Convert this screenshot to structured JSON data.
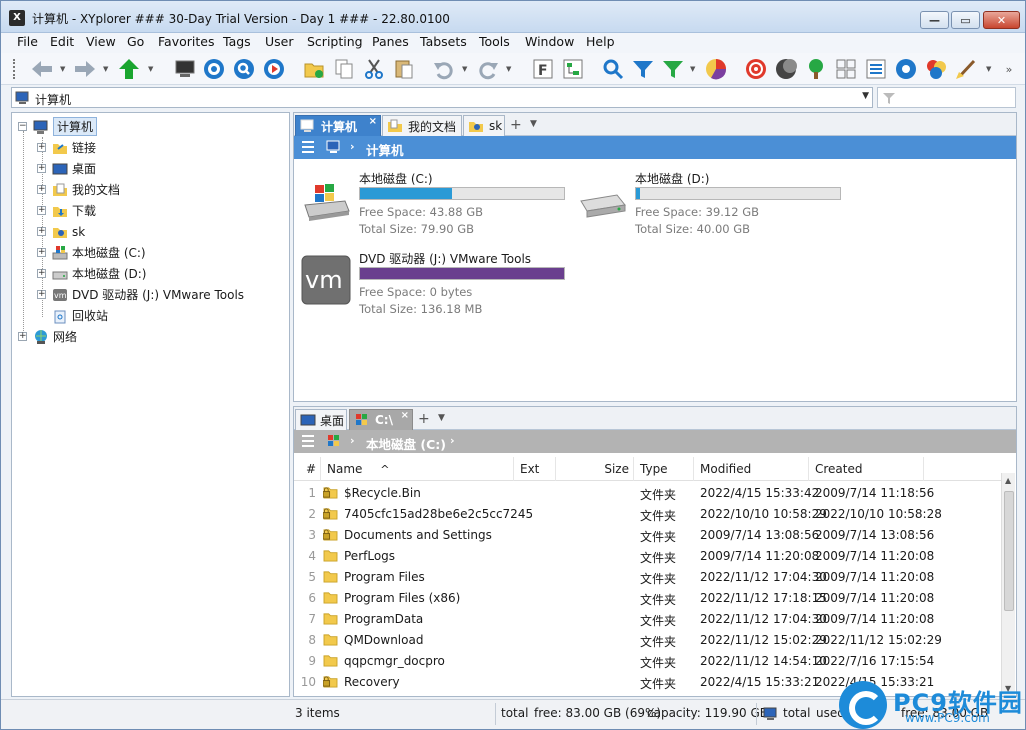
{
  "window": {
    "title": "计算机 - XYplorer ### 30-Day Trial Version - Day 1 ### - 22.80.0100",
    "app_icon_text": "X"
  },
  "menu": [
    "File",
    "Edit",
    "View",
    "Go",
    "Favorites",
    "Tags",
    "User",
    "Scripting",
    "Panes",
    "Tabsets",
    "Tools",
    "Window",
    "Help"
  ],
  "toolbar_icons": [
    "back-arrow-icon",
    "forward-arrow-icon",
    "up-arrow-icon",
    "computer-icon",
    "target-icon",
    "find-icon",
    "go-icon",
    "new-folder-icon",
    "copy-icon",
    "cut-icon",
    "paste-icon",
    "undo-icon",
    "redo-icon",
    "f-icon",
    "tree-icon",
    "search-icon",
    "filter-icon",
    "filter-green-icon",
    "pie-icon",
    "spiral-icon",
    "moon-icon",
    "tree-green-icon",
    "grid-icon",
    "list-icon",
    "gear-icon",
    "colors-icon",
    "brush-icon"
  ],
  "address": {
    "value": "计算机"
  },
  "tree": [
    {
      "label": "计算机",
      "level": 0
    },
    {
      "label": "链接",
      "level": 1
    },
    {
      "label": "桌面",
      "level": 1
    },
    {
      "label": "我的文档",
      "level": 1
    },
    {
      "label": "下载",
      "level": 1
    },
    {
      "label": "sk",
      "level": 1
    },
    {
      "label": "本地磁盘 (C:)",
      "level": 1
    },
    {
      "label": "本地磁盘 (D:)",
      "level": 1
    },
    {
      "label": "DVD 驱动器 (J:) VMware Tools",
      "level": 1
    },
    {
      "label": "回收站",
      "level": 1
    },
    {
      "label": "网络",
      "level": 0
    }
  ],
  "pane1": {
    "tabs": [
      {
        "label": "计算机",
        "active": true
      },
      {
        "label": "我的文档",
        "active": false
      },
      {
        "label": "sk",
        "active": false
      }
    ],
    "tab_close": "×",
    "tab_add": "+",
    "tab_more": "▼",
    "breadcrumb": "计算机",
    "drives": [
      {
        "name": "本地磁盘 (C:)",
        "free": "Free Space: 43.88 GB",
        "total": "Total Size: 79.90 GB",
        "used_fraction": 0.45,
        "color": "#2a9ad6"
      },
      {
        "name": "本地磁盘 (D:)",
        "free": "Free Space: 39.12 GB",
        "total": "Total Size: 40.00 GB",
        "used_fraction": 0.02,
        "color": "#2a9ad6"
      },
      {
        "name": "DVD 驱动器 (J:) VMware Tools",
        "free": "Free Space: 0 bytes",
        "total": "Total Size: 136.18 MB",
        "used_fraction": 1.0,
        "color": "#6a3f8e",
        "logo": "vm"
      }
    ]
  },
  "pane2": {
    "tabs": [
      {
        "label": "桌面",
        "active": false
      },
      {
        "label": "C:\\",
        "active": true
      }
    ],
    "tab_close": "×",
    "tab_add": "+",
    "tab_more": "▼",
    "breadcrumb": "本地磁盘 (C:)",
    "sort_arrow": "^",
    "columns": [
      "#",
      "Name",
      "Ext",
      "Size",
      "Type",
      "Modified",
      "Created"
    ],
    "rows": [
      {
        "n": "1",
        "name": "$Recycle.Bin",
        "type": "文件夹",
        "modified": "2022/4/15 15:33:42",
        "created": "2009/7/14 11:18:56",
        "locked": true
      },
      {
        "n": "2",
        "name": "7405cfc15ad28be6e2c5cc7245",
        "type": "文件夹",
        "modified": "2022/10/10 10:58:29",
        "created": "2022/10/10 10:58:28",
        "locked": true
      },
      {
        "n": "3",
        "name": "Documents and Settings",
        "type": "文件夹",
        "modified": "2009/7/14 13:08:56",
        "created": "2009/7/14 13:08:56",
        "locked": true
      },
      {
        "n": "4",
        "name": "PerfLogs",
        "type": "文件夹",
        "modified": "2009/7/14 11:20:08",
        "created": "2009/7/14 11:20:08",
        "locked": false
      },
      {
        "n": "5",
        "name": "Program Files",
        "type": "文件夹",
        "modified": "2022/11/12 17:04:30",
        "created": "2009/7/14 11:20:08",
        "locked": false
      },
      {
        "n": "6",
        "name": "Program Files (x86)",
        "type": "文件夹",
        "modified": "2022/11/12 17:18:15",
        "created": "2009/7/14 11:20:08",
        "locked": false
      },
      {
        "n": "7",
        "name": "ProgramData",
        "type": "文件夹",
        "modified": "2022/11/12 17:04:30",
        "created": "2009/7/14 11:20:08",
        "locked": false
      },
      {
        "n": "8",
        "name": "QMDownload",
        "type": "文件夹",
        "modified": "2022/11/12 15:02:29",
        "created": "2022/11/12 15:02:29",
        "locked": false
      },
      {
        "n": "9",
        "name": "qqpcmgr_docpro",
        "type": "文件夹",
        "modified": "2022/11/12 14:54:10",
        "created": "2022/7/16 17:15:54",
        "locked": false
      },
      {
        "n": "10",
        "name": "Recovery",
        "type": "文件夹",
        "modified": "2022/4/15 15:33:21",
        "created": "2022/4/15 15:33:21",
        "locked": true
      }
    ]
  },
  "status": {
    "items": "3 items",
    "total": "total",
    "free": "free: 83.00 GB (69%)",
    "capacity": "capacity: 119.90 GB",
    "total2": "total",
    "used": "used",
    "free2": "free: 83.00 GB"
  },
  "watermark": {
    "brand": "PC9软件园",
    "site": "www.PC9.com"
  }
}
